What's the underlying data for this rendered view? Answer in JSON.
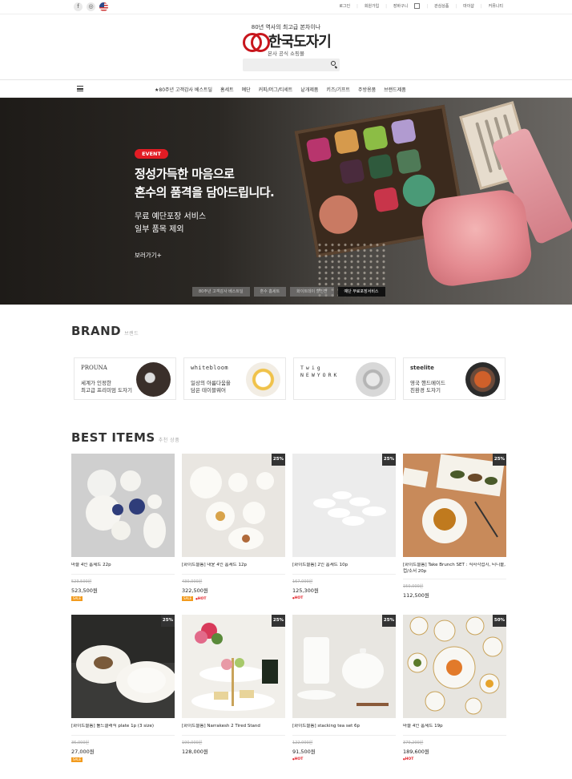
{
  "topbar": {
    "social": [
      "f",
      "◎"
    ],
    "util_links": [
      "로그인",
      "회원가입",
      "장바구니",
      "관심상품",
      "마이샵",
      "커뮤니티"
    ]
  },
  "header": {
    "tagline": "80년 역사의 최고급 본차이나",
    "logo_text": "한국도자기",
    "logo_sub": "본사 공식 쇼핑몰",
    "brand_color": "#c8161d"
  },
  "nav": {
    "items": [
      "★80주년 고객감사 베스트딜",
      "홈세트",
      "예단",
      "커피/머그/티세트",
      "낱개제품",
      "키즈/기프트",
      "주방용품",
      "브랜드제품"
    ]
  },
  "hero": {
    "badge": "EVENT",
    "title_line1": "정성가득한 마음으로",
    "title_line2": "혼수의 품격을 담아드립니다.",
    "sub_line1": "무료 예단포장 서비스",
    "sub_line2": "일부 품목 제외",
    "more": "보러가기+",
    "tabs": [
      "80주년 고객감사 베스트딜",
      "혼수 홈세트",
      "화이트데이 할인전",
      "예단 무료포장서비스"
    ],
    "accent_color": "#e21c24"
  },
  "brand_section": {
    "title": "BRAND",
    "subtitle": "브랜드",
    "brands": [
      {
        "logo": "PROUNA",
        "line1": "세계가 인정한",
        "line2": "최고급 프리미엄 도자기"
      },
      {
        "logo": "whitebloom",
        "line1": "일상의 아름다움을",
        "line2": "담은 테이블웨어"
      },
      {
        "logo": "Twig NEWYORK",
        "line1": "",
        "line2": ""
      },
      {
        "logo": "steelite",
        "line1": "영국 핸드메이드",
        "line2": "친환경 도자기"
      }
    ]
  },
  "best_section": {
    "title": "BEST ITEMS",
    "subtitle": "추천 상품",
    "row1": [
      {
        "name": "마블 4인 홈세트 22p",
        "old": "523,500원",
        "price": "523,500원",
        "sale": "",
        "tags": [
          "SALE"
        ]
      },
      {
        "name": "[화이트블룸] 대윤 4인 홈세트 12p",
        "old": "430,000원",
        "price": "322,500원",
        "sale": "25%",
        "tags": [
          "SALE",
          "HOT"
        ]
      },
      {
        "name": "[화이트블룸] 2인 홈세트 10p",
        "old": "167,000원",
        "price": "125,300원",
        "sale": "25%",
        "tags": [
          "HOT"
        ]
      },
      {
        "name": "[화이트블룸] Take Brunch SET : 직사각접시, 티니볼, 컵/소서 20p",
        "old": "150,000원",
        "price": "112,500원",
        "sale": "25%",
        "tags": []
      }
    ],
    "row2": [
      {
        "name": "[화이트블룸] 룰드클래식 plate 1p (3 size)",
        "old": "36,000원",
        "price": "27,000원",
        "sale": "25%",
        "tags": [
          "SALE"
        ]
      },
      {
        "name": "[화이트블룸] Narrakesh 2 Tired Stand",
        "old": "190,000원",
        "price": "128,000원",
        "sale": "25%",
        "tags": []
      },
      {
        "name": "[화이트블룸] stacking tea set 6p",
        "old": "122,000원",
        "price": "91,500원",
        "sale": "25%",
        "tags": [
          "HOT"
        ]
      },
      {
        "name": "마블 4인 홈세트 19p",
        "old": "379,200원",
        "price": "189,600원",
        "sale": "50%",
        "tags": [
          "HOT"
        ]
      }
    ]
  }
}
